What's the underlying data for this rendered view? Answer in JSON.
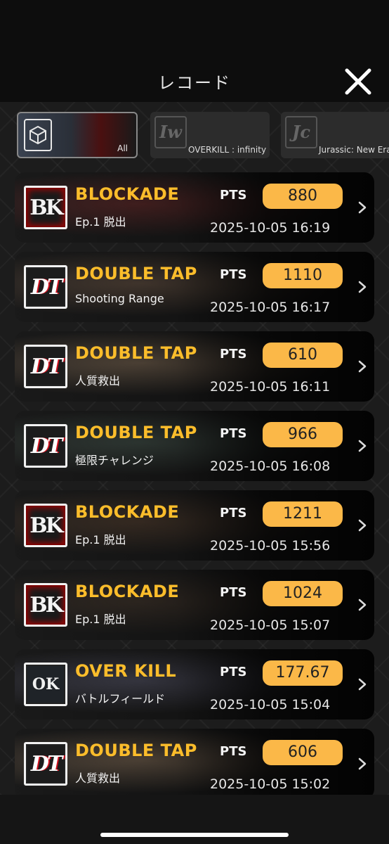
{
  "header": {
    "title": "レコード"
  },
  "filters": {
    "all": {
      "label": "All"
    },
    "overkill": {
      "logo": "Iw",
      "label": "OVERKILL : infinity"
    },
    "jurassic": {
      "logo": "Jc",
      "label": "Jurassic: New Era"
    }
  },
  "records": [
    {
      "game": "BLOCKADE",
      "logo": "BK",
      "logo_style": "bk",
      "stage": "Ep.1 脱出",
      "pts_label": "PTS",
      "score": "880",
      "time": "2025-10-05 16:19",
      "bg": "#5a2a2a"
    },
    {
      "game": "DOUBLE TAP",
      "logo": "DT",
      "logo_style": "dt",
      "stage": "Shooting Range",
      "pts_label": "PTS",
      "score": "1110",
      "time": "2025-10-05 16:17",
      "bg": "#5a4a3e"
    },
    {
      "game": "DOUBLE TAP",
      "logo": "DT",
      "logo_style": "dt",
      "stage": "人質救出",
      "pts_label": "PTS",
      "score": "610",
      "time": "2025-10-05 16:11",
      "bg": "#6a5a4a"
    },
    {
      "game": "DOUBLE TAP",
      "logo": "DT",
      "logo_style": "dt",
      "stage": "極限チャレンジ",
      "pts_label": "PTS",
      "score": "966",
      "time": "2025-10-05 16:08",
      "bg": "#3e4a44"
    },
    {
      "game": "BLOCKADE",
      "logo": "BK",
      "logo_style": "bk",
      "stage": "Ep.1 脱出",
      "pts_label": "PTS",
      "score": "1211",
      "time": "2025-10-05 15:56",
      "bg": "#4a3a2e"
    },
    {
      "game": "BLOCKADE",
      "logo": "BK",
      "logo_style": "bk",
      "stage": "Ep.1 脱出",
      "pts_label": "PTS",
      "score": "1024",
      "time": "2025-10-05 15:07",
      "bg": "#3e342c"
    },
    {
      "game": "OVER KILL",
      "logo": "OK",
      "logo_style": "ok",
      "stage": "バトルフィールド",
      "pts_label": "PTS",
      "score": "177.67",
      "time": "2025-10-05 15:04",
      "bg": "#4a4a58"
    },
    {
      "game": "DOUBLE TAP",
      "logo": "DT",
      "logo_style": "dt",
      "stage": "人質救出",
      "pts_label": "PTS",
      "score": "606",
      "time": "2025-10-05 15:02",
      "bg": "#6a5a4a"
    }
  ],
  "colors": {
    "accent": "#fbbd2b",
    "badge": "#fbb848"
  }
}
